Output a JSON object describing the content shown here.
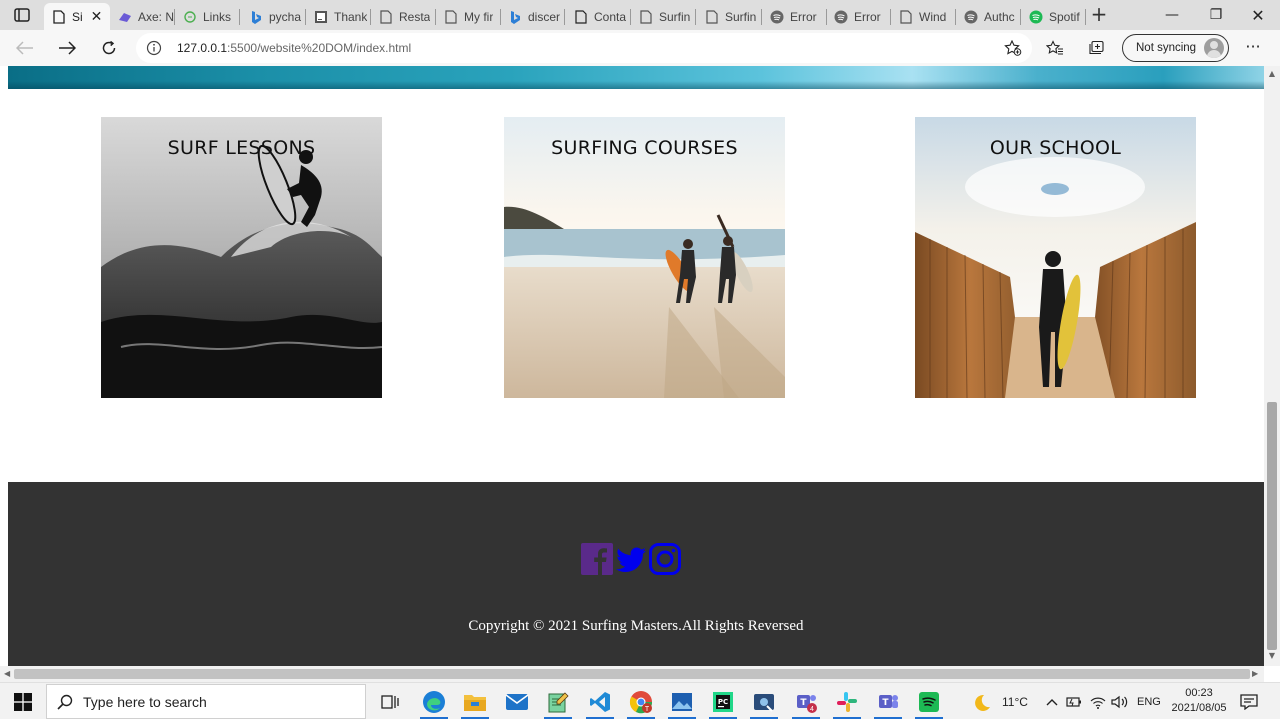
{
  "browser": {
    "active_tab": {
      "title": "Si",
      "close": "✕"
    },
    "tabs": [
      {
        "title": "Axe: N",
        "icon": "axe-icon",
        "color": "#6b5bd6"
      },
      {
        "title": "Links ",
        "icon": "links-icon",
        "color": "#4caf50"
      },
      {
        "title": "pycha",
        "icon": "bing-icon",
        "color": "#2d7fd6"
      },
      {
        "title": "Thank",
        "icon": "jetbrains-icon",
        "color": "#555555"
      },
      {
        "title": "Resta",
        "icon": "page-icon",
        "color": "#555555"
      },
      {
        "title": "My fir",
        "icon": "page-icon",
        "color": "#555555"
      },
      {
        "title": "discer",
        "icon": "bing-icon",
        "color": "#2d7fd6"
      },
      {
        "title": "Conta",
        "icon": "page-icon",
        "color": "#222222"
      },
      {
        "title": "Surfin",
        "icon": "page-icon",
        "color": "#555555"
      },
      {
        "title": "Surfin",
        "icon": "page-icon",
        "color": "#555555"
      },
      {
        "title": "Error",
        "icon": "spotify-gray-icon",
        "color": "#666666"
      },
      {
        "title": "Error ",
        "icon": "spotify-gray-icon",
        "color": "#666666"
      },
      {
        "title": "Wind",
        "icon": "page-icon",
        "color": "#555555"
      },
      {
        "title": "Authc",
        "icon": "spotify-gray-icon",
        "color": "#666666"
      },
      {
        "title": "Spotif",
        "icon": "spotify-icon",
        "color": "#1db954"
      }
    ],
    "new_tab": "+",
    "window_controls": {
      "minimize": "—",
      "restore": "❐",
      "close": "✕"
    },
    "url_host": "127.0.0.1",
    "url_path": ":5500/website%20DOM/index.html",
    "sync_label": "Not syncing",
    "more": "···"
  },
  "page": {
    "cards": [
      {
        "title": "SURF LESSONS"
      },
      {
        "title": "SURFING COURSES"
      },
      {
        "title": "OUR SCHOOL"
      }
    ],
    "footer": {
      "social": [
        {
          "name": "facebook",
          "color": "#5a2a8a"
        },
        {
          "name": "twitter",
          "color": "#0000ee"
        },
        {
          "name": "instagram",
          "color": "#0000ee"
        }
      ],
      "copyright": "Copyright © 2021 Surfing Masters.All Rights Reversed"
    }
  },
  "taskbar": {
    "search_placeholder": "Type here to search",
    "weather": "11°C",
    "language": "ENG",
    "time": "00:23",
    "date": "2021/08/05",
    "teams_badge": "4"
  }
}
